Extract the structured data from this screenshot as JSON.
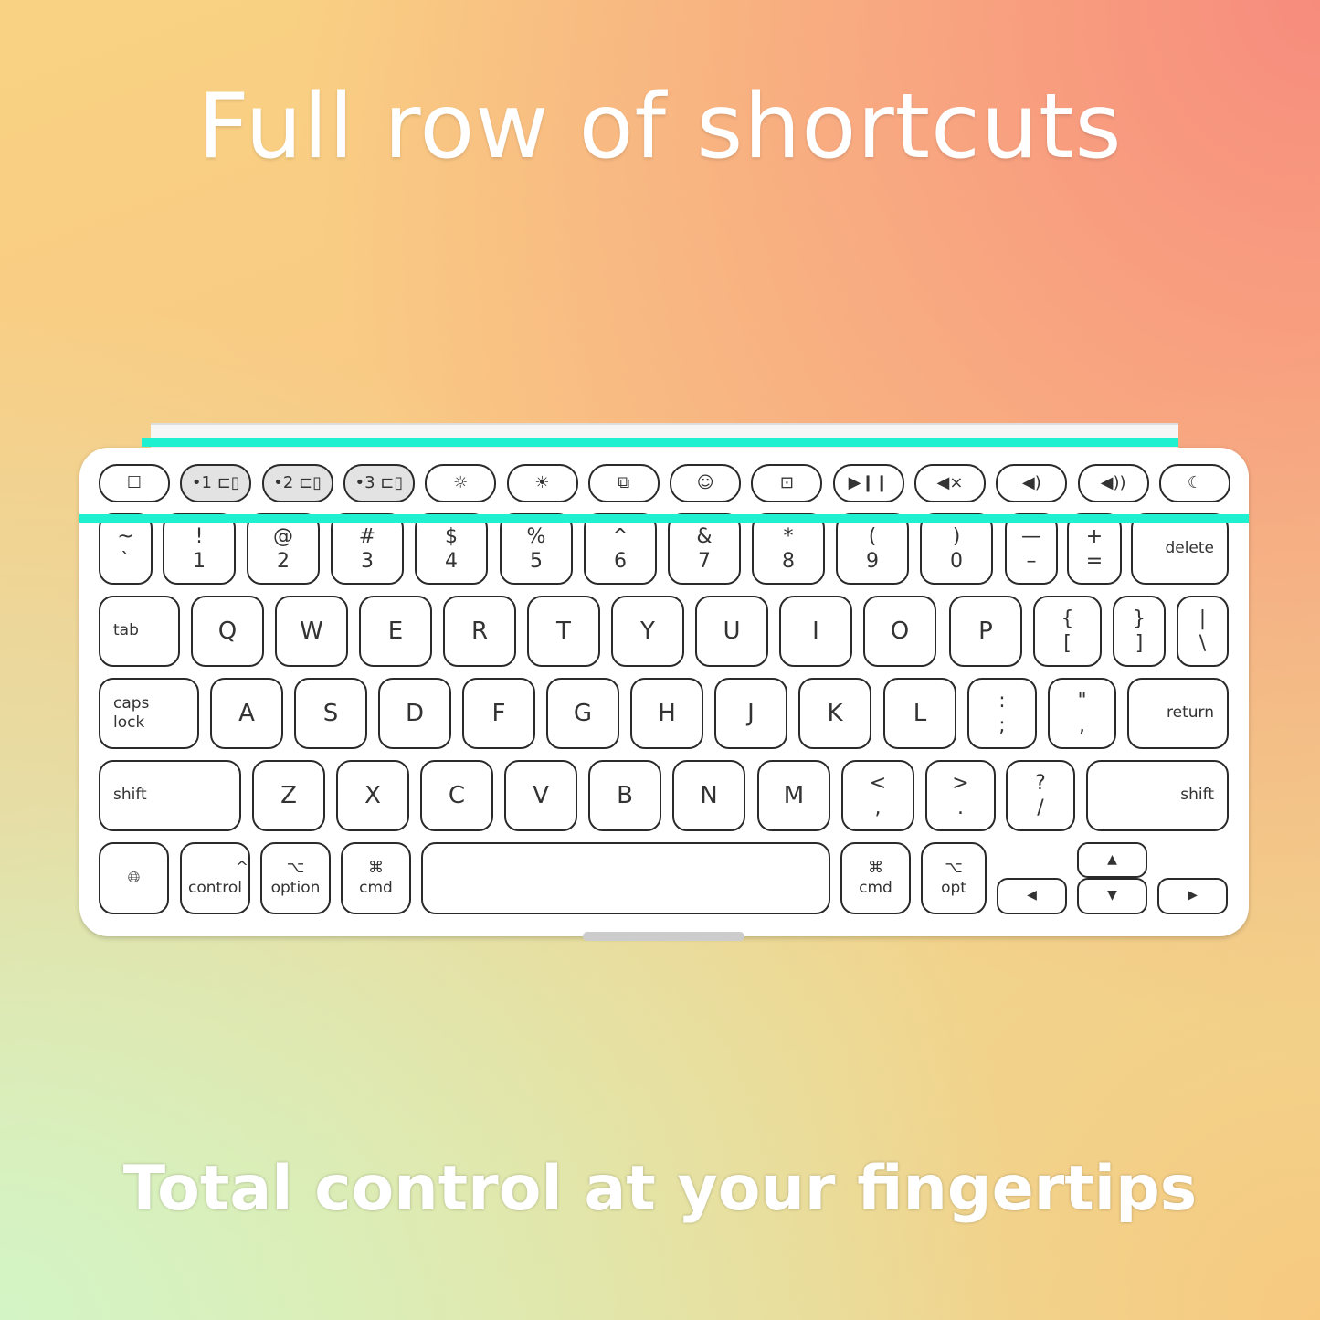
{
  "headline": "Full row of shortcuts",
  "tagline": "Total control at your fingertips",
  "colors": {
    "highlight": "#1ff0d0",
    "keyboard": "#ffffff",
    "key_outline": "#2a2a2a"
  },
  "function_row": [
    {
      "icon": "square-icon",
      "glyph": "☐"
    },
    {
      "icon": "device-1-icon",
      "glyph": "•1 ⊏▯"
    },
    {
      "icon": "device-2-icon",
      "glyph": "•2 ⊏▯"
    },
    {
      "icon": "device-3-icon",
      "glyph": "•3 ⊏▯"
    },
    {
      "icon": "brightness-down-icon",
      "glyph": "☼"
    },
    {
      "icon": "brightness-up-icon",
      "glyph": "☀"
    },
    {
      "icon": "app-switch-icon",
      "glyph": "⧉"
    },
    {
      "icon": "emoji-icon",
      "glyph": "☺"
    },
    {
      "icon": "screenshot-icon",
      "glyph": "⊡"
    },
    {
      "icon": "play-pause-icon",
      "glyph": "▶❙❙"
    },
    {
      "icon": "mute-icon",
      "glyph": "◀×"
    },
    {
      "icon": "volume-down-icon",
      "glyph": "◀)"
    },
    {
      "icon": "volume-up-icon",
      "glyph": "◀))"
    },
    {
      "icon": "moon-icon",
      "glyph": "☾"
    }
  ],
  "rows": [
    [
      {
        "t": "~",
        "b": "`"
      },
      {
        "t": "!",
        "b": "1"
      },
      {
        "t": "@",
        "b": "2"
      },
      {
        "t": "#",
        "b": "3"
      },
      {
        "t": "$",
        "b": "4"
      },
      {
        "t": "%",
        "b": "5"
      },
      {
        "t": "^",
        "b": "6"
      },
      {
        "t": "&",
        "b": "7"
      },
      {
        "t": "*",
        "b": "8"
      },
      {
        "t": "(",
        "b": "9"
      },
      {
        "t": ")",
        "b": "0"
      },
      {
        "t": "—",
        "b": "–"
      },
      {
        "t": "+",
        "b": "="
      },
      {
        "l": "delete"
      }
    ],
    [
      {
        "l": "tab"
      },
      {
        "l": "Q"
      },
      {
        "l": "W"
      },
      {
        "l": "E"
      },
      {
        "l": "R"
      },
      {
        "l": "T"
      },
      {
        "l": "Y"
      },
      {
        "l": "U"
      },
      {
        "l": "I"
      },
      {
        "l": "O"
      },
      {
        "l": "P"
      },
      {
        "t": "{",
        "b": "["
      },
      {
        "t": "}",
        "b": "]"
      },
      {
        "t": "|",
        "b": "\\"
      }
    ],
    [
      {
        "l": "caps lock"
      },
      {
        "l": "A"
      },
      {
        "l": "S"
      },
      {
        "l": "D"
      },
      {
        "l": "F"
      },
      {
        "l": "G"
      },
      {
        "l": "H"
      },
      {
        "l": "J"
      },
      {
        "l": "K"
      },
      {
        "l": "L"
      },
      {
        "t": ":",
        "b": ";"
      },
      {
        "t": "\"",
        "b": ","
      },
      {
        "l": "return"
      }
    ],
    [
      {
        "l": "shift"
      },
      {
        "l": "Z"
      },
      {
        "l": "X"
      },
      {
        "l": "C"
      },
      {
        "l": "V"
      },
      {
        "l": "B"
      },
      {
        "l": "N"
      },
      {
        "l": "M"
      },
      {
        "t": "<",
        "b": ","
      },
      {
        "t": ">",
        "b": "."
      },
      {
        "t": "?",
        "b": "/"
      },
      {
        "l": "shift"
      }
    ],
    [
      {
        "t": "",
        "b": "🌐︎",
        "icon": "globe-icon"
      },
      {
        "t": "^",
        "b": "control"
      },
      {
        "t": "⌥",
        "b": "option"
      },
      {
        "t": "⌘",
        "b": "cmd"
      },
      {
        "l": ""
      },
      {
        "t": "⌘",
        "b": "cmd"
      },
      {
        "t": "⌥",
        "b": "opt"
      },
      {
        "l": "◀"
      },
      {
        "l": "▲"
      },
      {
        "l": "▼"
      },
      {
        "l": "▶"
      }
    ]
  ]
}
